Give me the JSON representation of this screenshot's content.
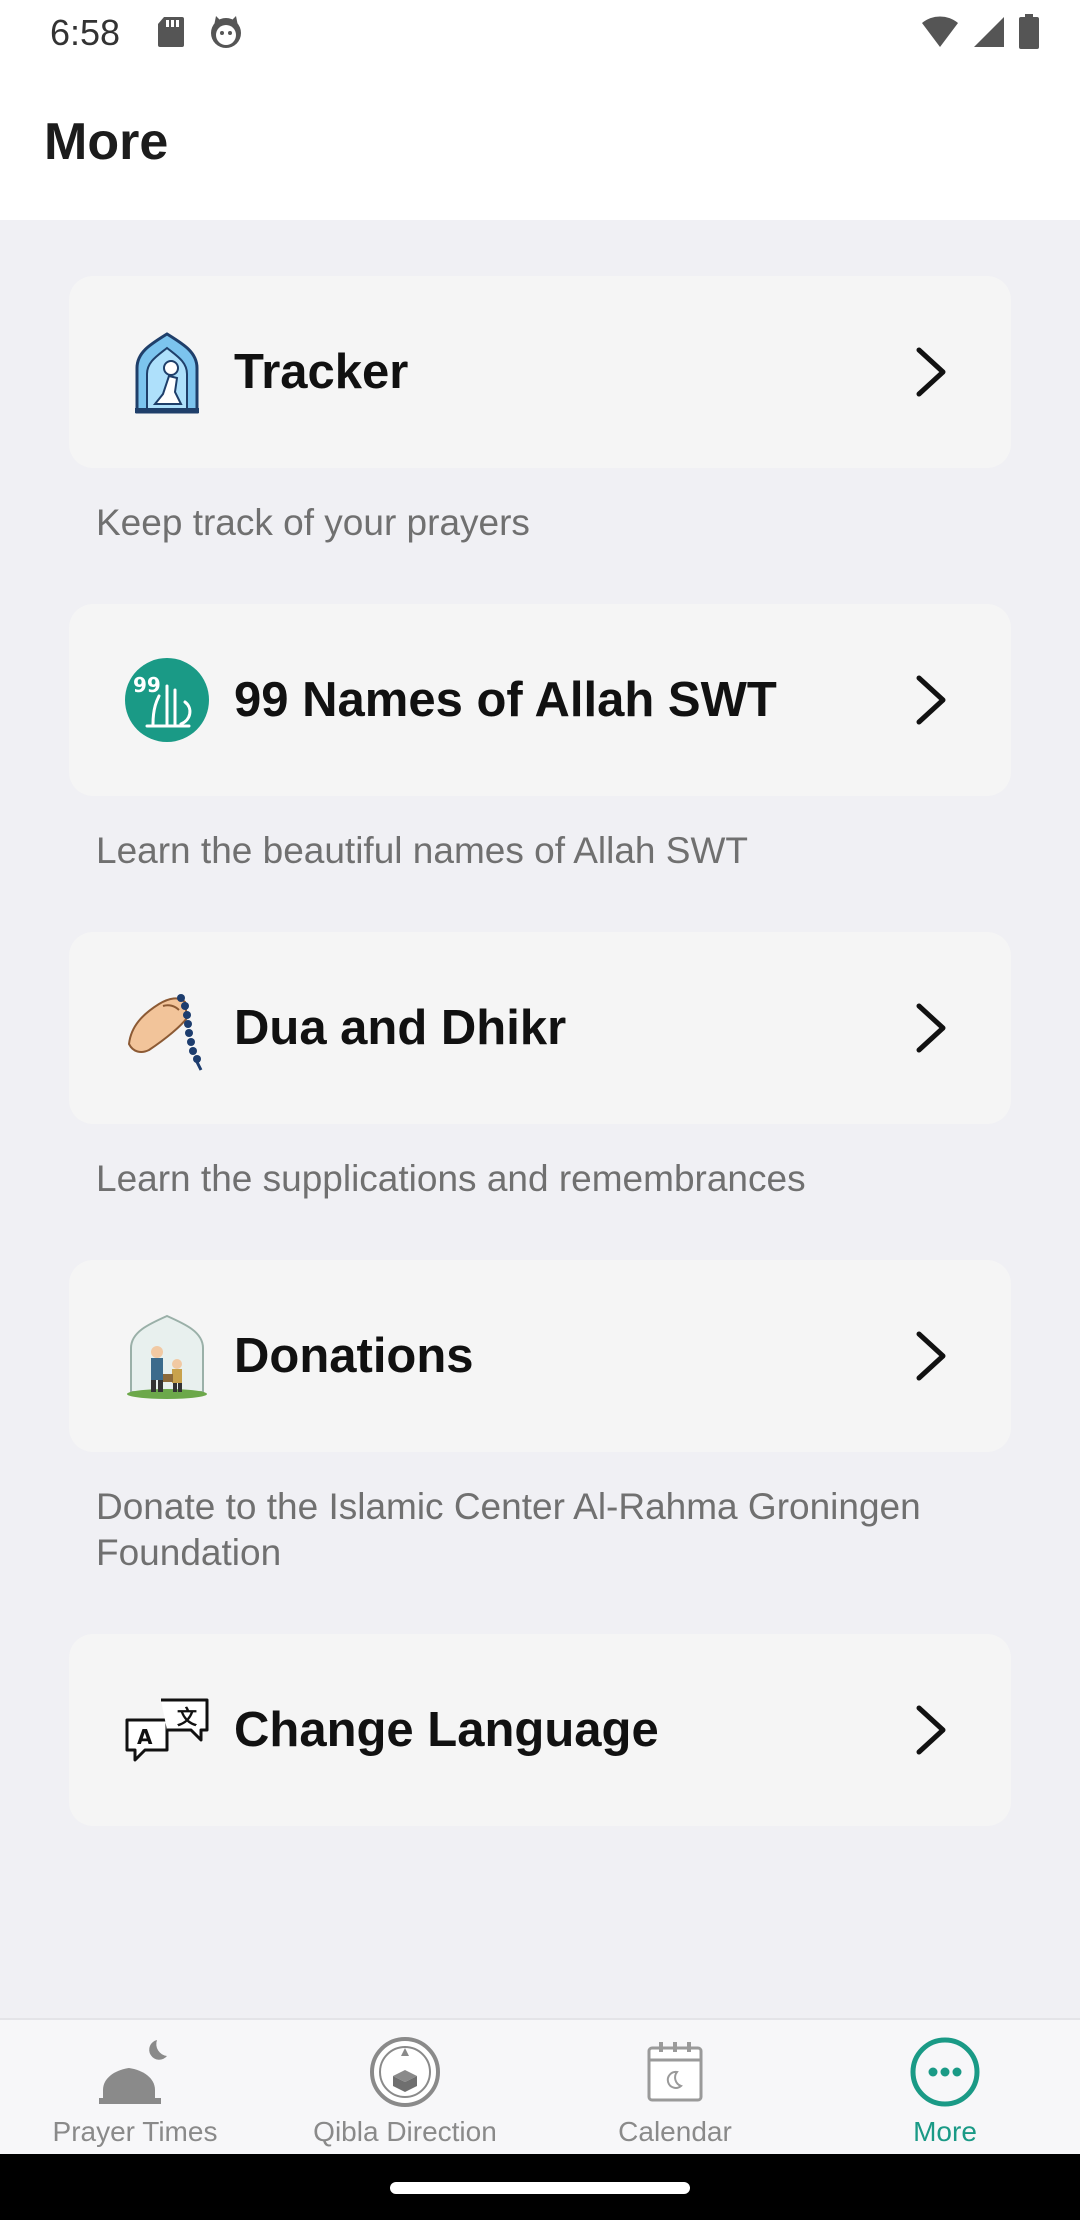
{
  "status": {
    "time": "6:58"
  },
  "app_bar": {
    "title": "More"
  },
  "items": [
    {
      "label": "Tracker",
      "icon": "prayer-tracker-icon",
      "description": "Keep track of your prayers"
    },
    {
      "label": "99 Names of Allah SWT",
      "icon": "99-names-icon",
      "description": "Learn the beautiful names of Allah SWT"
    },
    {
      "label": "Dua and Dhikr",
      "icon": "prayer-beads-icon",
      "description": "Learn the supplications and remembrances"
    },
    {
      "label": "Donations",
      "icon": "donations-icon",
      "description": "Donate to the Islamic Center Al-Rahma Groningen Foundation"
    },
    {
      "label": "Change Language",
      "icon": "translate-icon"
    }
  ],
  "bottom_nav": {
    "items": [
      {
        "label": "Prayer Times",
        "icon": "mosque-moon-icon",
        "active": false
      },
      {
        "label": "Qibla Direction",
        "icon": "compass-kaaba-icon",
        "active": false
      },
      {
        "label": "Calendar",
        "icon": "calendar-icon",
        "active": false
      },
      {
        "label": "More",
        "icon": "more-dots-icon",
        "active": true
      }
    ],
    "active_color": "#1a9a86"
  },
  "colors": {
    "accent": "#1a9a86",
    "card": "#f5f5f5",
    "background": "#f0f0f4"
  }
}
